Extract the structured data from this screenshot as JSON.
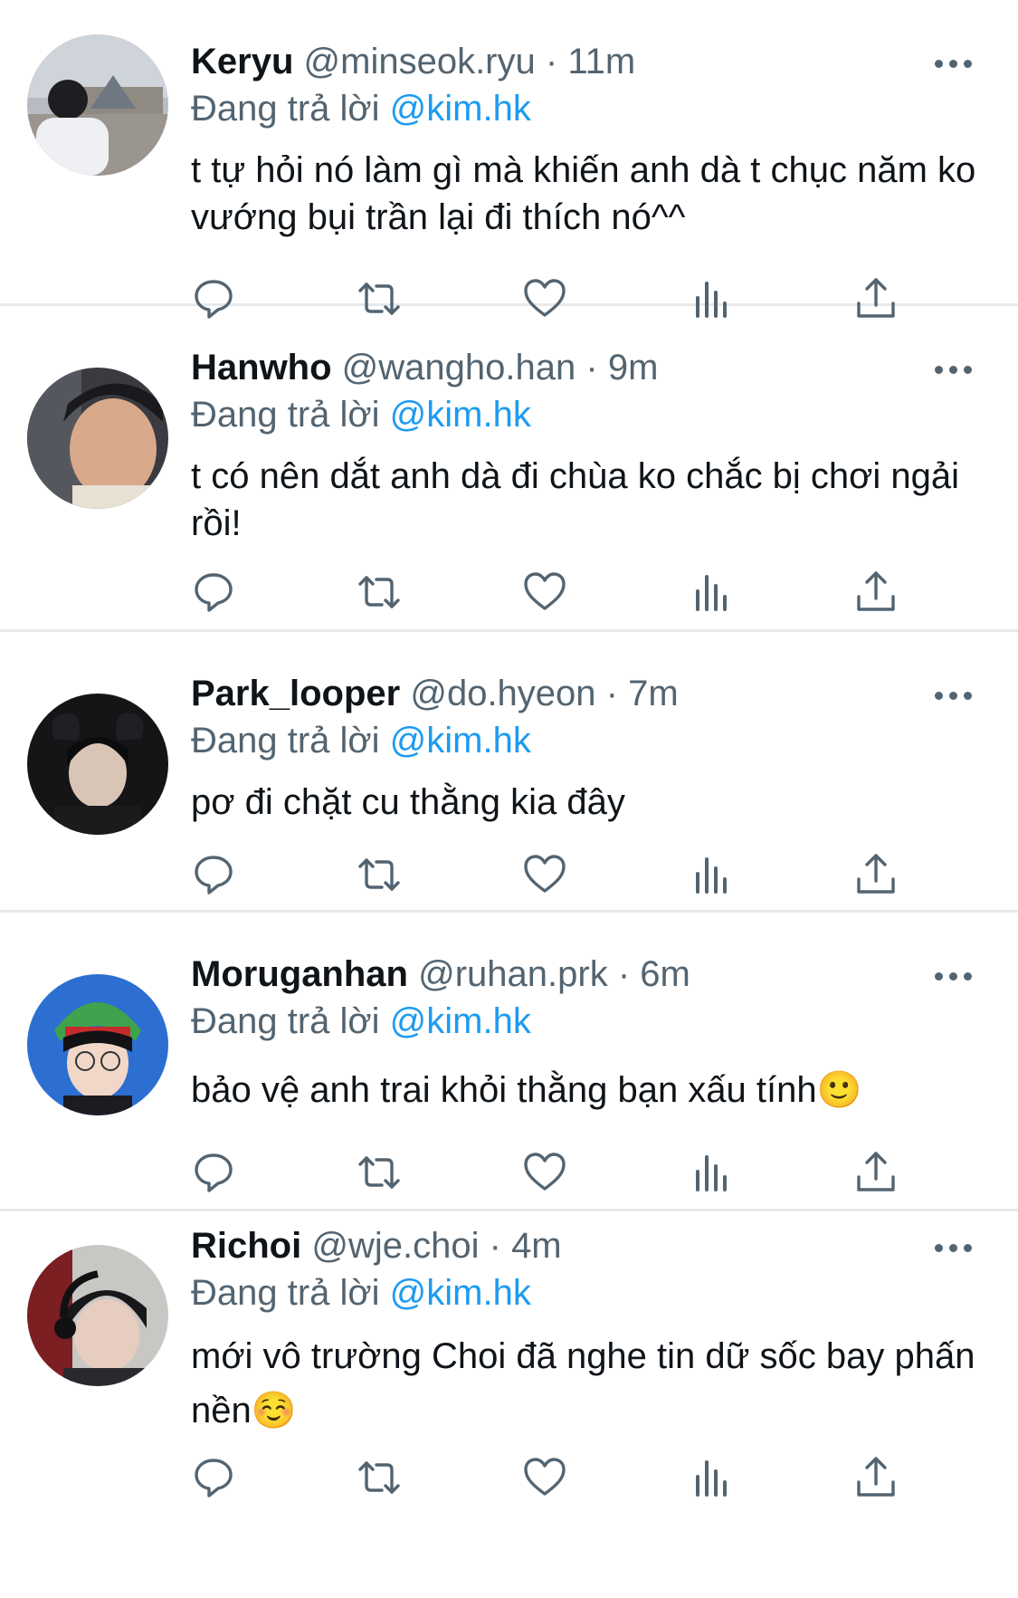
{
  "replies": [
    {
      "name": "Keryu",
      "handle": "@minseok.ryu",
      "separator": "·",
      "time": "11m",
      "replying_prefix": "Đang trả lời",
      "replying_to": "@kim.hk",
      "text": "t tự hỏi nó làm gì mà khiến anh dà t chục năm ko vướng bụi trần lại đi thích nó^^"
    },
    {
      "name": "Hanwho",
      "handle": "@wangho.han",
      "separator": "·",
      "time": "9m",
      "replying_prefix": "Đang trả lời",
      "replying_to": "@kim.hk",
      "text": "t có nên dắt anh dà đi chùa ko chắc bị chơi ngải rồi!"
    },
    {
      "name": "Park_looper",
      "handle": "@do.hyeon",
      "separator": "·",
      "time": "7m",
      "replying_prefix": "Đang trả lời",
      "replying_to": "@kim.hk",
      "text": "pơ đi chặt cu thằng kia đây"
    },
    {
      "name": "Moruganhan",
      "handle": "@ruhan.prk",
      "separator": "·",
      "time": "6m",
      "replying_prefix": "Đang trả lời",
      "replying_to": "@kim.hk",
      "text": "bảo vệ anh trai khỏi thằng bạn xấu tính🙂"
    },
    {
      "name": "Richoi",
      "handle": "@wje.choi",
      "separator": "·",
      "time": "4m",
      "replying_prefix": "Đang trả lời",
      "replying_to": "@kim.hk",
      "text": "mới vô trường Choi đã nghe tin dữ sốc bay phấn nền☺️"
    }
  ],
  "icons": {
    "reply": "reply-icon",
    "retweet": "retweet-icon",
    "like": "heart-icon",
    "views": "views-icon",
    "share": "share-icon",
    "more": "more-icon"
  },
  "colors": {
    "text": "#0f1419",
    "secondary": "#536471",
    "link": "#1d9bf0",
    "divider": "#e6e9ec"
  }
}
